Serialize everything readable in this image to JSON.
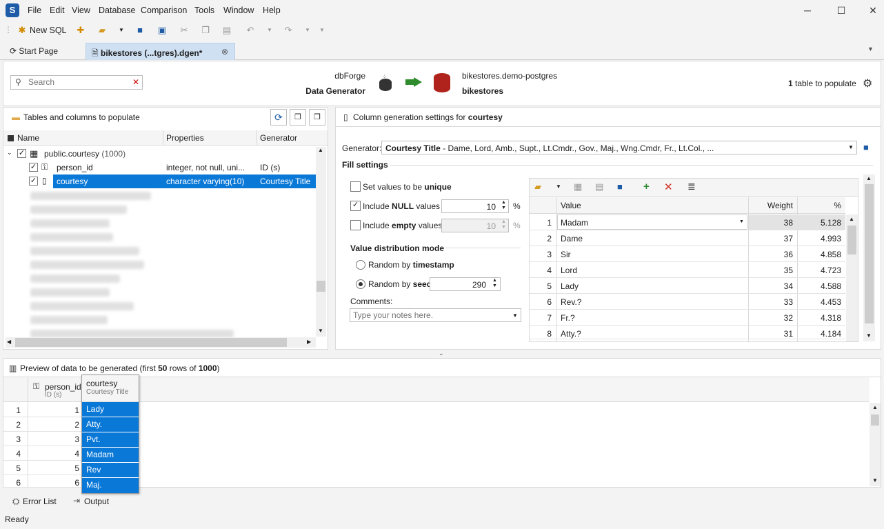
{
  "app": {
    "logo_letter": "S",
    "menu": [
      "File",
      "Edit",
      "View",
      "Database",
      "Comparison",
      "Tools",
      "Window",
      "Help"
    ]
  },
  "toolbar": {
    "new_sql": "New SQL"
  },
  "tabs": [
    {
      "label": "Start Page"
    },
    {
      "label": "bikestores (...tgres).dgen*"
    }
  ],
  "header": {
    "search_placeholder": "Search",
    "product_line1": "dbForge",
    "product_line2": "Data Generator",
    "target_line1": "bikestores.demo-postgres",
    "target_line2": "bikestores",
    "tables_count": "1",
    "tables_text": " table to populate"
  },
  "left_panel": {
    "title": "Tables and columns to populate",
    "columns": [
      "Name",
      "Properties",
      "Generator"
    ],
    "table_name": "public.courtesy",
    "table_count": " (1000)",
    "rows": [
      {
        "name": "person_id",
        "properties": "integer, not null, uni...",
        "generator": "ID (s)"
      },
      {
        "name": "courtesy",
        "properties": "character varying(10)",
        "generator": "Courtesy Title"
      }
    ]
  },
  "right_panel": {
    "title_prefix": "Column generation settings for ",
    "title_column": "courtesy",
    "generator_label": "Generator:",
    "generator_name": "Courtesy Title",
    "generator_desc": " - Dame, Lord, Amb., Supt., Lt.Cmdr., Gov., Maj., Wng.Cmdr, Fr., Lt.Col., ...",
    "fill_settings": "Fill settings",
    "unique_pre": "Set values to be ",
    "unique_bold": "unique",
    "null_pre": "Include ",
    "null_bold": "NULL",
    "null_post": " values",
    "null_value": "10",
    "empty_pre": "Include ",
    "empty_bold": "empty",
    "empty_post": " values",
    "empty_value": "10",
    "percent": "%",
    "distribution_title": "Value distribution mode",
    "random_ts_pre": "Random by ",
    "random_ts_bold": "timestamp",
    "random_seed_pre": "Random by ",
    "random_seed_bold": "seed",
    "seed_value": "290",
    "comments_label": "Comments:",
    "comments_placeholder": "Type your notes here.",
    "value_columns": [
      "Value",
      "Weight",
      "%"
    ],
    "values": [
      {
        "n": "1",
        "value": "Madam",
        "weight": "38",
        "pct": "5.128"
      },
      {
        "n": "2",
        "value": "Dame",
        "weight": "37",
        "pct": "4.993"
      },
      {
        "n": "3",
        "value": "Sir",
        "weight": "36",
        "pct": "4.858"
      },
      {
        "n": "4",
        "value": "Lord",
        "weight": "35",
        "pct": "4.723"
      },
      {
        "n": "5",
        "value": "Lady",
        "weight": "34",
        "pct": "4.588"
      },
      {
        "n": "6",
        "value": "Rev.?",
        "weight": "33",
        "pct": "4.453"
      },
      {
        "n": "7",
        "value": "Fr.?",
        "weight": "32",
        "pct": "4.318"
      },
      {
        "n": "8",
        "value": "Atty.?",
        "weight": "31",
        "pct": "4.184"
      }
    ]
  },
  "preview": {
    "title_pre": "Preview of data to be generated (first ",
    "title_rows": "50",
    "title_mid": " rows of ",
    "title_total": "1000",
    "title_post": ")",
    "col1_name": "person_id",
    "col1_gen": "ID (s)",
    "col2_name": "courtesy",
    "col2_gen": "Courtesy Title",
    "rows": [
      {
        "n": "1",
        "id": "1",
        "courtesy": "Lady"
      },
      {
        "n": "2",
        "id": "2",
        "courtesy": "Atty."
      },
      {
        "n": "3",
        "id": "3",
        "courtesy": "Pvt."
      },
      {
        "n": "4",
        "id": "4",
        "courtesy": "Madam"
      },
      {
        "n": "5",
        "id": "5",
        "courtesy": "Rev"
      },
      {
        "n": "6",
        "id": "6",
        "courtesy": "Maj."
      }
    ]
  },
  "bottom_tabs": {
    "error_list": "Error List",
    "output": "Output"
  },
  "status": {
    "text": "Ready"
  }
}
